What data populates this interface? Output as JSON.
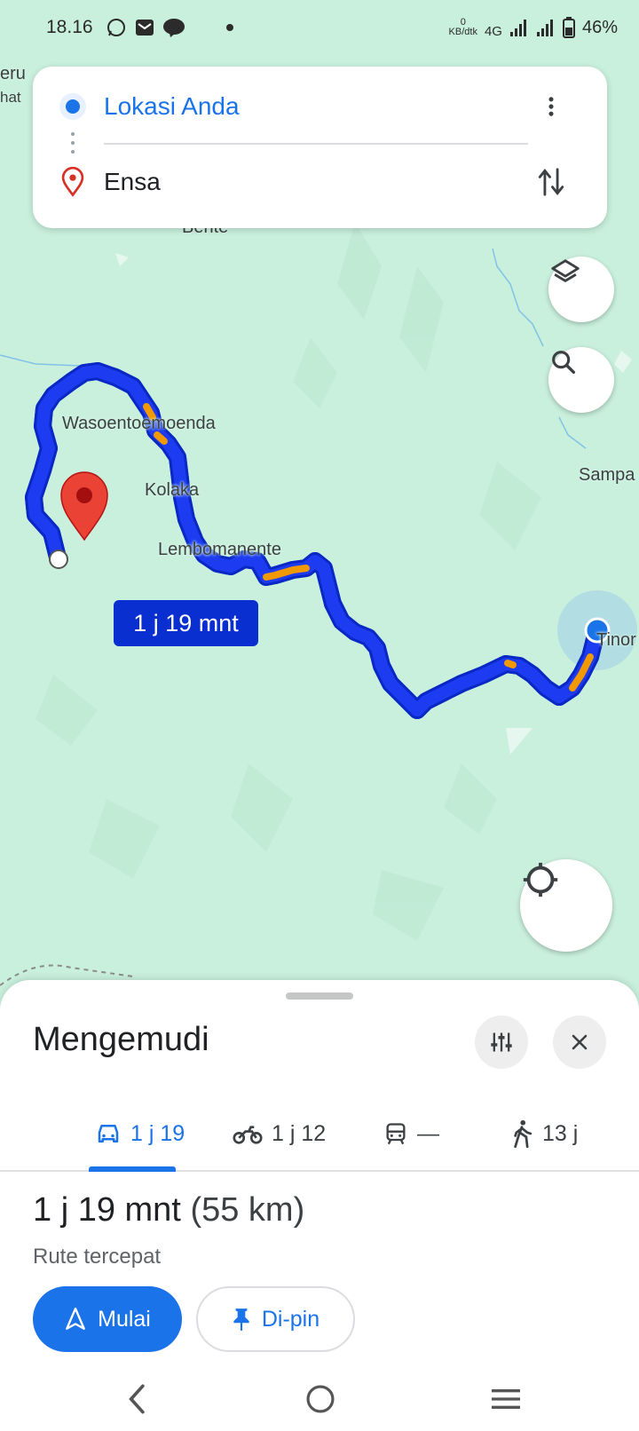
{
  "status_bar": {
    "time": "18.16",
    "data_rate_value": "0",
    "data_rate_unit": "KB/dtk",
    "network": "4G",
    "battery": "46%"
  },
  "search": {
    "origin": "Lokasi Anda",
    "destination": "Ensa"
  },
  "map": {
    "labels": {
      "top_left_1": "eru",
      "top_left_2": "hat",
      "bente": "Bente",
      "wasoentoemoenda": "Wasoentoemoenda",
      "kolaka": "Kolaka",
      "lembomanente": "Lembomanente",
      "sampa": "Sampa",
      "tinor": "Tinor"
    },
    "route_time": "1 j 19 mnt"
  },
  "sheet": {
    "title": "Mengemudi",
    "tabs": [
      {
        "label": "1 j 19",
        "icon": "car-icon"
      },
      {
        "label": "1 j 12",
        "icon": "motorcycle-icon"
      },
      {
        "label": "—",
        "icon": "transit-icon"
      },
      {
        "label": "13 j",
        "icon": "walk-icon"
      }
    ],
    "duration": "1 j 19 mnt",
    "distance": "(55 km)",
    "route_desc": "Rute tercepat",
    "start_label": "Mulai",
    "pin_label": "Di-pin"
  },
  "colors": {
    "route": "#1d3cf2",
    "traffic": "#f29900",
    "accent": "#1a73e8",
    "map_bg": "#c9f0dd"
  }
}
